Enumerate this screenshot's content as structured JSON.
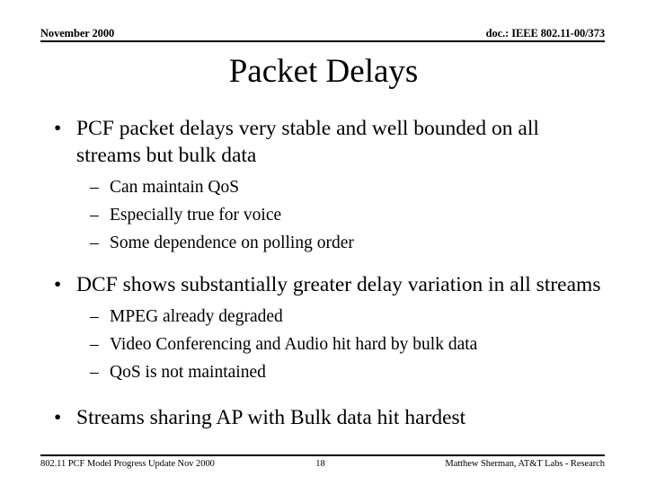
{
  "header": {
    "left": "November 2000",
    "right": "doc.: IEEE 802.11-00/373"
  },
  "title": "Packet Delays",
  "bullet_markers": {
    "level1": "•",
    "level2": "–"
  },
  "content": {
    "blocks": [
      {
        "main": "PCF packet delays very stable and well bounded on all streams but bulk data",
        "sub": [
          "Can maintain QoS",
          "Especially true for voice",
          "Some dependence on polling order"
        ]
      },
      {
        "main": "DCF shows substantially greater delay variation in all streams",
        "sub": [
          "MPEG already degraded",
          "Video Conferencing and Audio hit hard by bulk data",
          "QoS is not maintained"
        ]
      },
      {
        "main": "Streams sharing AP with Bulk data hit hardest",
        "sub": []
      }
    ]
  },
  "footer": {
    "left": "802.11 PCF Model Progress Update Nov 2000",
    "page": "18",
    "right": "Matthew Sherman, AT&T Labs - Research"
  }
}
